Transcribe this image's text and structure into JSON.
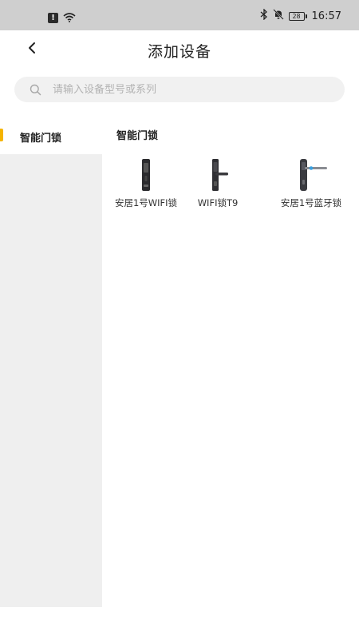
{
  "status_bar": {
    "alert_icon": "!",
    "battery_level": "28",
    "time": "16:57",
    "icons": [
      "wifi-icon",
      "bluetooth-icon",
      "mute-bell-icon",
      "battery-icon"
    ]
  },
  "header": {
    "title": "添加设备",
    "back_icon": "chevron-left-icon"
  },
  "search": {
    "placeholder": "请输入设备型号或系列",
    "value": ""
  },
  "sidebar": {
    "items": [
      {
        "label": "智能门锁",
        "selected": true
      }
    ],
    "accent_color": "#f5b400"
  },
  "content": {
    "section_title": "智能门锁",
    "devices": [
      {
        "label": "安居1号WIFI锁",
        "icon": "lock-vertical-panel"
      },
      {
        "label": "WIFI锁T9",
        "icon": "lock-handle-panel"
      },
      {
        "label": "安居1号蓝牙锁",
        "icon": "lock-long-handle"
      }
    ]
  }
}
